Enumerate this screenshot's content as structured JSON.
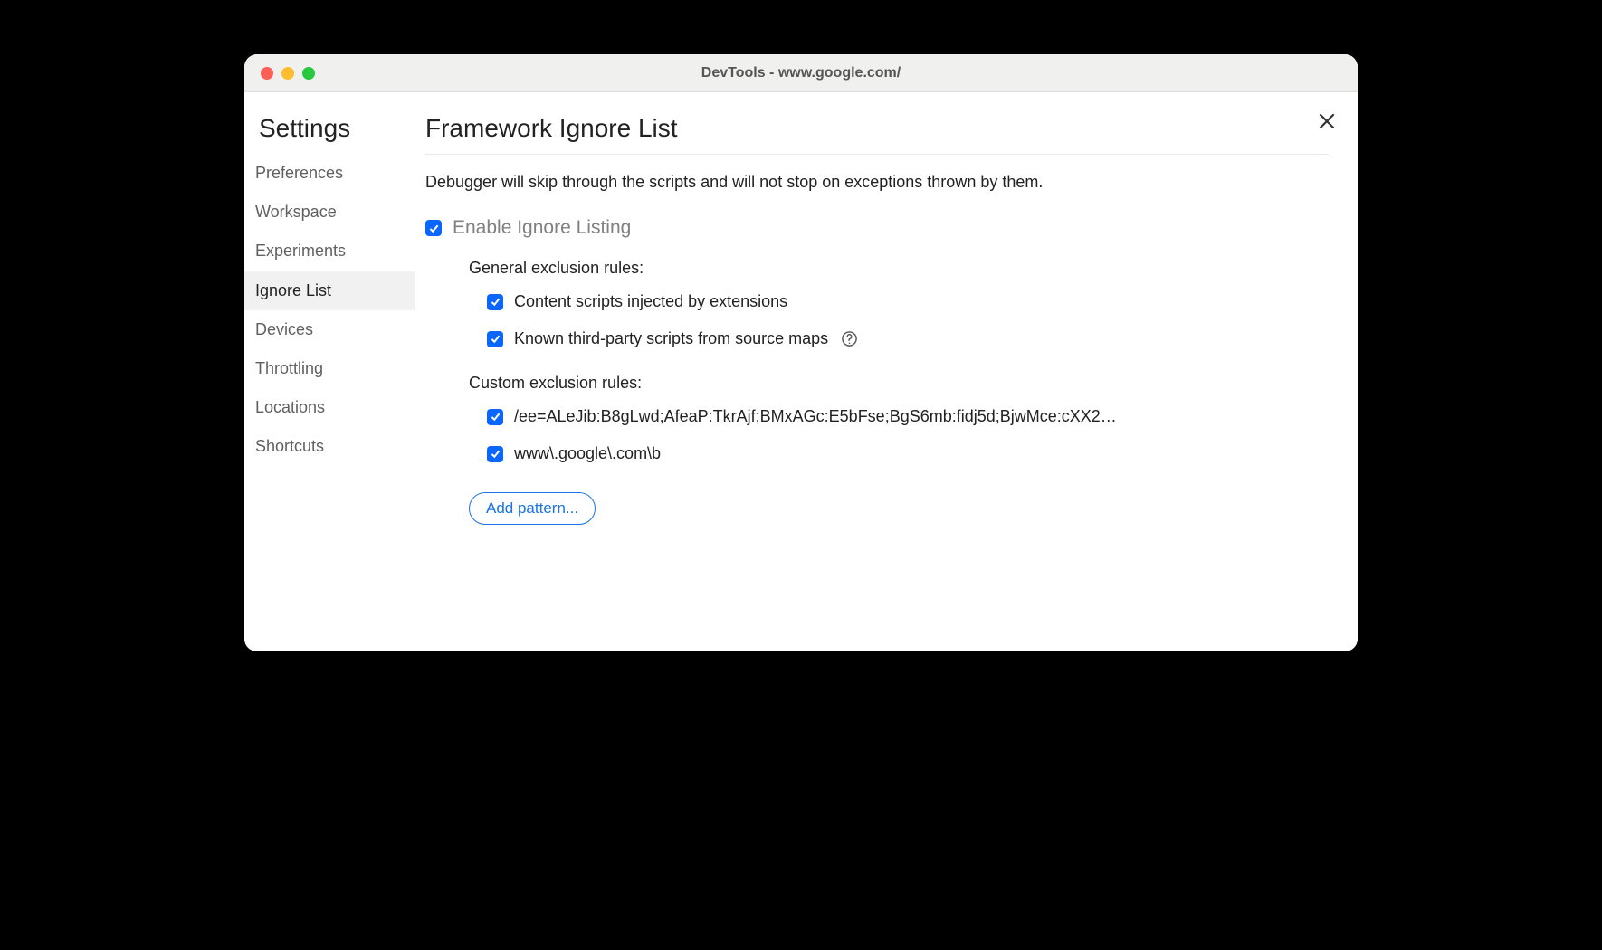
{
  "window": {
    "title": "DevTools - www.google.com/"
  },
  "sidebar": {
    "title": "Settings",
    "items": [
      {
        "label": "Preferences",
        "active": false
      },
      {
        "label": "Workspace",
        "active": false
      },
      {
        "label": "Experiments",
        "active": false
      },
      {
        "label": "Ignore List",
        "active": true
      },
      {
        "label": "Devices",
        "active": false
      },
      {
        "label": "Throttling",
        "active": false
      },
      {
        "label": "Locations",
        "active": false
      },
      {
        "label": "Shortcuts",
        "active": false
      }
    ]
  },
  "main": {
    "title": "Framework Ignore List",
    "description": "Debugger will skip through the scripts and will not stop on exceptions thrown by them.",
    "enable_label": "Enable Ignore Listing",
    "enable_checked": true,
    "general_heading": "General exclusion rules:",
    "general_rules": [
      {
        "label": "Content scripts injected by extensions",
        "checked": true,
        "help": false
      },
      {
        "label": "Known third-party scripts from source maps",
        "checked": true,
        "help": true
      }
    ],
    "custom_heading": "Custom exclusion rules:",
    "custom_rules": [
      {
        "label": "/ee=ALeJib:B8gLwd;AfeaP:TkrAjf;BMxAGc:E5bFse;BgS6mb:fidj5d;BjwMce:cXX2…",
        "checked": true
      },
      {
        "label": "www\\.google\\.com\\b",
        "checked": true
      }
    ],
    "add_button": "Add pattern..."
  }
}
